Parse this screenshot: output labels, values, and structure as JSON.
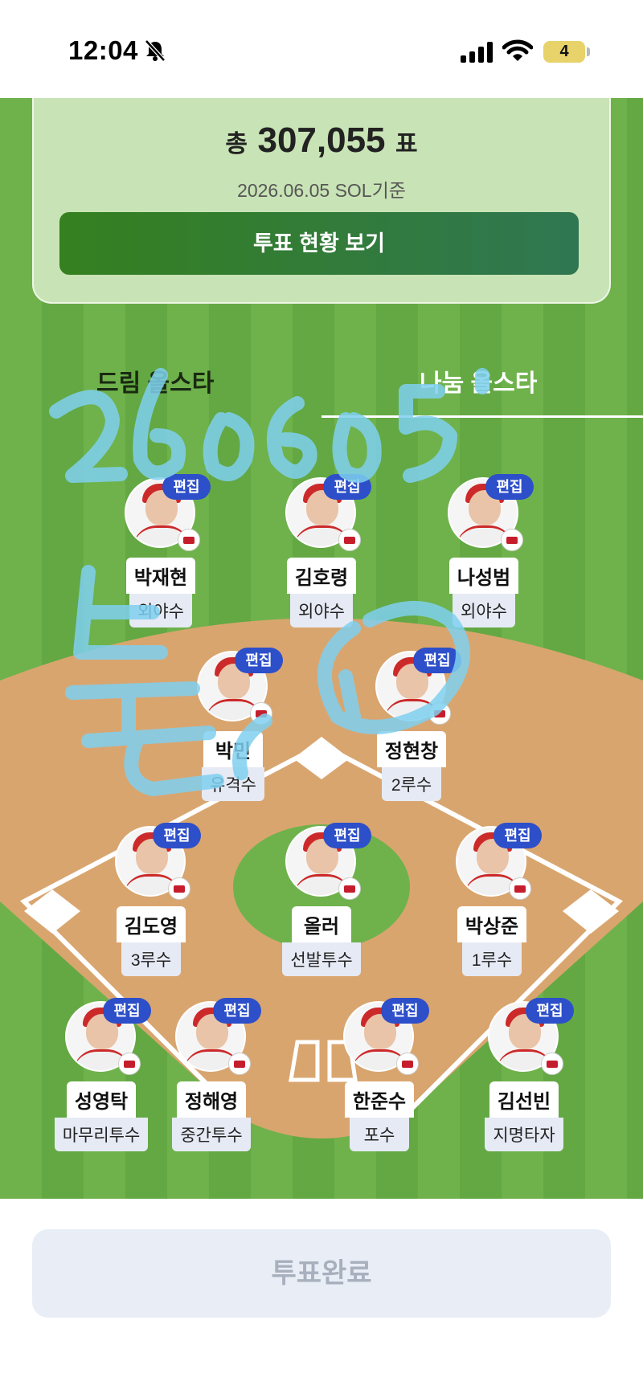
{
  "status_bar": {
    "time": "12:04",
    "battery": "4"
  },
  "summary": {
    "total_prefix": "총",
    "total_count": "307,055",
    "total_suffix": "표",
    "date_basis": "2026.06.05 SOL기준",
    "view_status_button": "투표 현황 보기"
  },
  "tabs": [
    {
      "label": "드림 올스타",
      "selected": false
    },
    {
      "label": "나눔 올스타",
      "selected": true
    }
  ],
  "edit_label": "편집",
  "players": [
    {
      "name": "박재현",
      "position": "외야수"
    },
    {
      "name": "김호령",
      "position": "외야수"
    },
    {
      "name": "나성범",
      "position": "외야수"
    },
    {
      "name": "박민",
      "position": "유격수"
    },
    {
      "name": "정현창",
      "position": "2루수"
    },
    {
      "name": "김도영",
      "position": "3루수"
    },
    {
      "name": "올러",
      "position": "선발투수"
    },
    {
      "name": "박상준",
      "position": "1루수"
    },
    {
      "name": "성영탁",
      "position": "마무리투수"
    },
    {
      "name": "정해영",
      "position": "중간투수"
    },
    {
      "name": "한준수",
      "position": "포수"
    },
    {
      "name": "김선빈",
      "position": "지명타자"
    }
  ],
  "handwriting": "260605 본인",
  "submit_button": "투표완료",
  "colors": {
    "field_green": "#6fb24c",
    "infield_dirt": "#d9a56f",
    "card_bg": "#c8e3b5",
    "primary_green": "#35801f",
    "edit_badge": "#2d4fc9",
    "handwriting": "#7fd0f0"
  }
}
